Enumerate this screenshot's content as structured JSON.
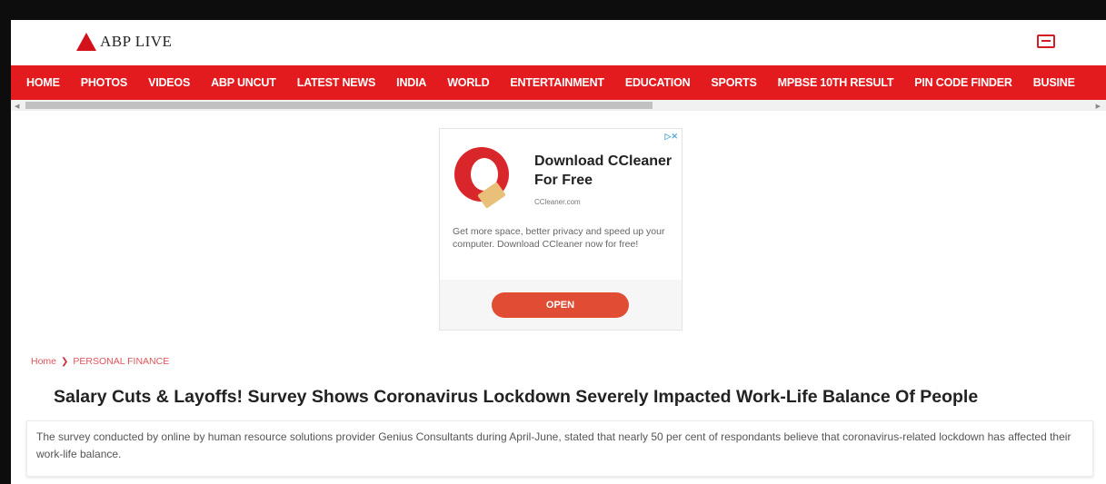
{
  "header": {
    "logo_text": "ABP LIVE",
    "icon": "live-tv-icon"
  },
  "nav": {
    "items": [
      "HOME",
      "PHOTOS",
      "VIDEOS",
      "ABP UNCUT",
      "LATEST NEWS",
      "INDIA",
      "WORLD",
      "ENTERTAINMENT",
      "EDUCATION",
      "SPORTS",
      "MPBSE 10TH RESULT",
      "PIN CODE FINDER",
      "BUSINE"
    ]
  },
  "ad": {
    "title": "Download CCleaner For Free",
    "url": "CCleaner.com",
    "body": "Get more space, better privacy and speed up your computer. Download CCleaner now for free!",
    "button": "OPEN",
    "choice": "▷✕"
  },
  "breadcrumb": {
    "home": "Home",
    "separator": "❯",
    "section": "PERSONAL FINANCE"
  },
  "article": {
    "headline": "Salary Cuts & Layoffs! Survey Shows Coronavirus Lockdown Severely Impacted Work-Life Balance Of People",
    "summary": "The survey conducted by online by human resource solutions provider Genius Consultants during April-June, stated that nearly 50 per cent of respondants believe that coronavirus-related lockdown has affected their work-life balance."
  },
  "colors": {
    "brand_red": "#e41b1e",
    "ad_button": "#e14d34"
  }
}
